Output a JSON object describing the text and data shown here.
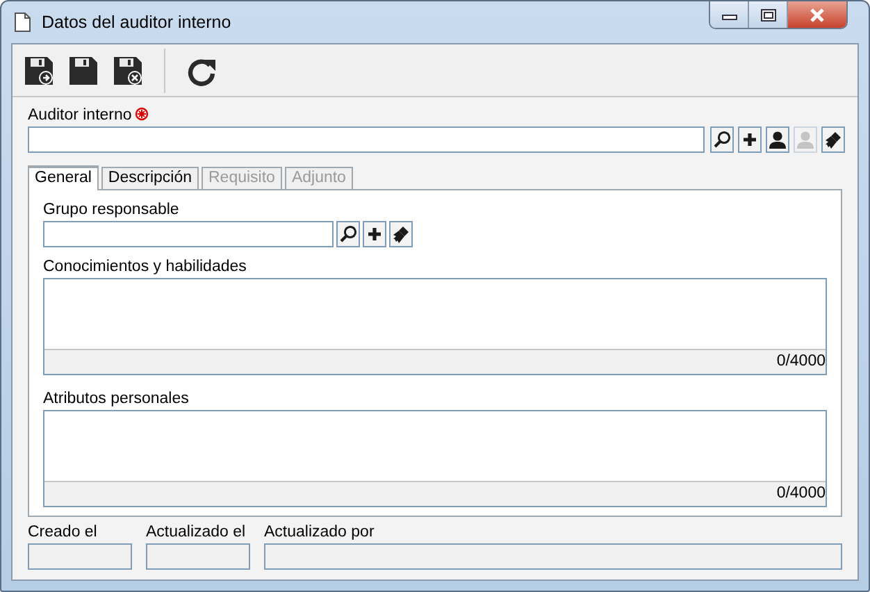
{
  "window": {
    "title": "Datos del auditor interno"
  },
  "toolbar": [
    {
      "kind": "save-new"
    },
    {
      "kind": "save"
    },
    {
      "kind": "save-close"
    },
    {
      "kind": "separator"
    },
    {
      "kind": "refresh"
    }
  ],
  "auditor": {
    "label": "Auditor interno",
    "required": true,
    "buttons": [
      {
        "kind": "search",
        "disabled": false
      },
      {
        "kind": "add",
        "disabled": false
      },
      {
        "kind": "user",
        "disabled": false
      },
      {
        "kind": "user",
        "disabled": true
      },
      {
        "kind": "clear",
        "disabled": false
      }
    ]
  },
  "tabs": [
    {
      "label": "General",
      "selected": true,
      "disabled": false
    },
    {
      "label": "Descripción",
      "selected": false,
      "disabled": false
    },
    {
      "label": "Requisito",
      "selected": false,
      "disabled": true
    },
    {
      "label": "Adjunto",
      "selected": false,
      "disabled": true
    }
  ],
  "group": {
    "label": "Grupo responsable",
    "buttons": [
      {
        "kind": "search",
        "disabled": false
      },
      {
        "kind": "add",
        "disabled": false
      },
      {
        "kind": "clear",
        "disabled": false
      }
    ]
  },
  "text_areas": [
    {
      "label": "Conocimientos y habilidades",
      "counter": "0/4000"
    },
    {
      "label": "Atributos personales",
      "counter": "0/4000"
    }
  ],
  "footer_fields": [
    {
      "label": "Creado el"
    },
    {
      "label": "Actualizado el"
    },
    {
      "label": "Actualizado por"
    }
  ]
}
